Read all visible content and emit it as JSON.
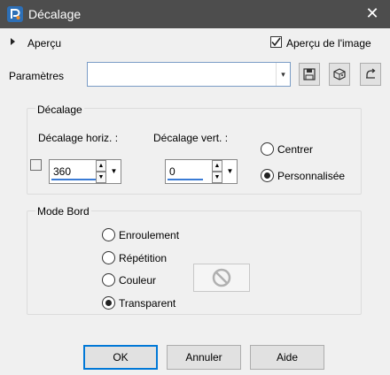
{
  "window": {
    "title": "Décalage",
    "close_glyph": "✕"
  },
  "preview": {
    "label": "Aperçu",
    "image_preview_label": "Aperçu de l'image",
    "image_preview_checked": true
  },
  "params": {
    "label": "Paramètres",
    "combo_value": "",
    "icons": [
      "save-icon",
      "load-preset-icon",
      "reset-icon"
    ]
  },
  "offset": {
    "group_title": "Décalage",
    "horiz_label": "Décalage horiz. :",
    "horiz_value": "360",
    "vert_label": "Décalage vert. :",
    "vert_value": "0",
    "radios": [
      {
        "label": "Centrer",
        "checked": false
      },
      {
        "label": "Personnalisée",
        "checked": true
      }
    ]
  },
  "edge_mode": {
    "group_title": "Mode Bord",
    "options": [
      {
        "label": "Enroulement",
        "checked": false
      },
      {
        "label": "Répétition",
        "checked": false
      },
      {
        "label": "Couleur",
        "checked": false
      },
      {
        "label": "Transparent",
        "checked": true
      }
    ]
  },
  "buttons": {
    "ok": "OK",
    "cancel": "Annuler",
    "help": "Aide"
  },
  "colors": {
    "titlebar": "#4d4d4d",
    "accent": "#0078d7"
  }
}
